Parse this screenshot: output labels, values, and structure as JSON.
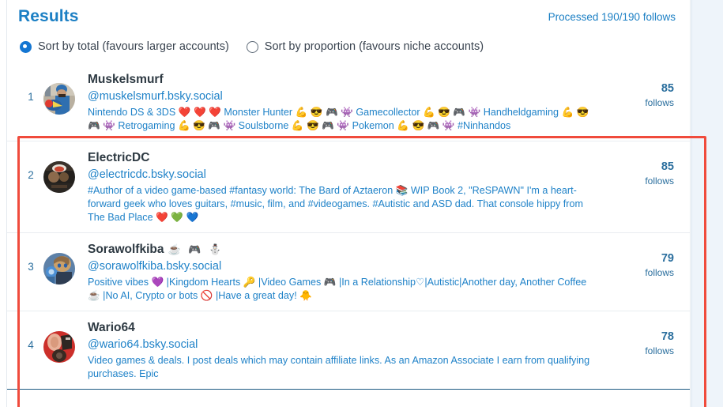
{
  "header": {
    "title": "Results",
    "processed": "Processed 190/190 follows"
  },
  "sort": {
    "options": [
      {
        "label": "Sort by total (favours larger accounts)",
        "selected": true
      },
      {
        "label": "Sort by proportion (favours niche accounts)",
        "selected": false
      }
    ]
  },
  "follows_label": "follows",
  "results": [
    {
      "rank": "1",
      "name": "Muskelsmurf",
      "name_emojis": "",
      "handle": "@muskelsmurf.bsky.social",
      "bio": "Nintendo DS & 3DS ❤️ ❤️ ❤️ Monster Hunter 💪 😎 🎮 👾 Gamecollector 💪 😎 🎮 👾 Handheldgaming 💪 😎 🎮 👾 Retrogaming 💪 😎 🎮 👾 Soulsborne 💪 😎 🎮 👾 Pokemon 💪 😎 🎮 👾 #Ninhandos",
      "follows": "85",
      "avatar_colors": [
        "#2f6fb0",
        "#bfb49a",
        "#e03a2f",
        "#f2d24a"
      ]
    },
    {
      "rank": "2",
      "name": "ElectricDC",
      "name_emojis": "",
      "handle": "@electricdc.bsky.social",
      "bio": "#Author of a video game-based #fantasy world: The Bard of Aztaeron 📚 WIP Book 2, \"ReSPAWN\" I'm a heart-forward geek who loves guitars, #music, film, and #videogames. #Autistic and ASD dad. That console hippy from The Bad Place ❤️ 💚 💙",
      "follows": "85",
      "avatar_colors": [
        "#2a211c",
        "#5d4632",
        "#c9452f",
        "#e8e2d8"
      ]
    },
    {
      "rank": "3",
      "name": "Sorawolfkiba",
      "name_emojis": "☕ 🎮 ⛄",
      "handle": "@sorawolfkiba.bsky.social",
      "bio": "Positive vibes 💜 |Kingdom Hearts 🔑 |Video Games 🎮 |In a Relationship♡|Autistic|Another day, Another Coffee ☕ |No AI, Crypto or bots 🚫 |Have a great day! 🐥",
      "follows": "79",
      "avatar_colors": [
        "#3c7fbd",
        "#c8a06a",
        "#8e6b45",
        "#e9d9bd"
      ]
    },
    {
      "rank": "4",
      "name": "Wario64",
      "name_emojis": "",
      "handle": "@wario64.bsky.social",
      "bio": "Video games & deals. I post deals which may contain affiliate links. As an Amazon Associate I earn from qualifying purchases. Epic",
      "follows": "78",
      "avatar_colors": [
        "#cc2f2a",
        "#e3a98e",
        "#3a2a22",
        "#f0c9ae"
      ]
    }
  ]
}
